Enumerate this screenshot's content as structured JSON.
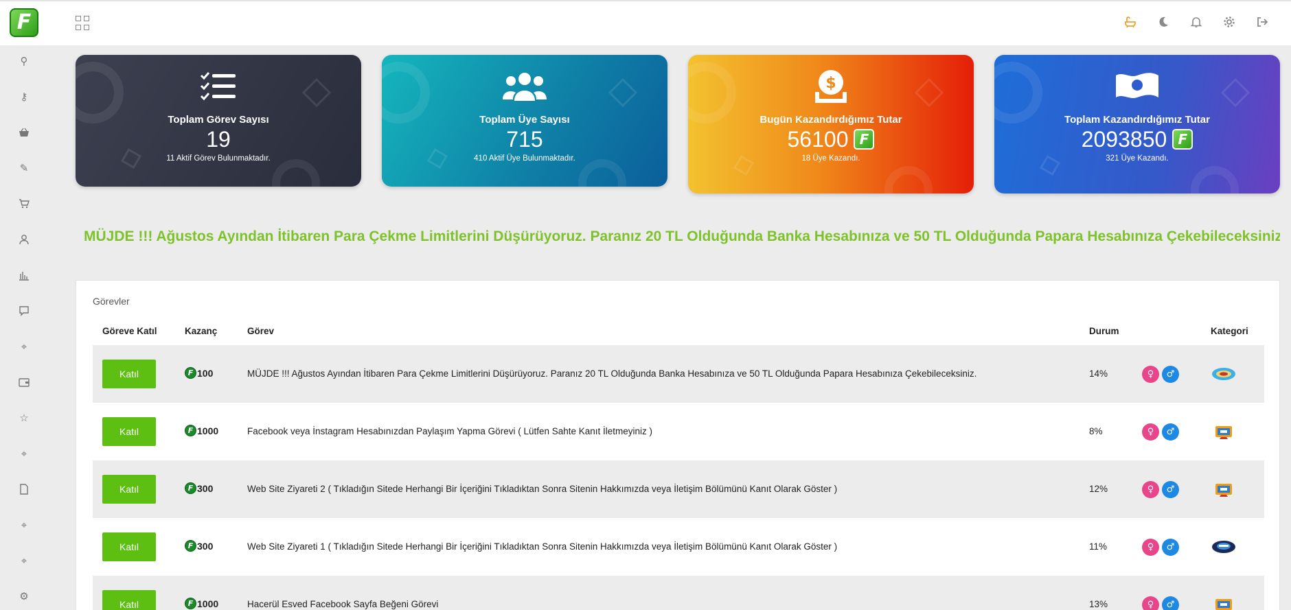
{
  "topbar": {
    "logo_letter": "F",
    "icons": [
      "bath-icon",
      "moon-icon",
      "bell-icon",
      "gear-icon",
      "logout-icon"
    ]
  },
  "sidebar": {
    "icons": [
      "key-icon",
      "key-alt-icon",
      "basket-icon",
      "pen-icon",
      "cart-icon",
      "user-icon",
      "chart-icon",
      "chat-icon",
      "target-icon",
      "wallet-icon",
      "star-icon",
      "target-icon",
      "file-icon",
      "target-icon",
      "target-icon",
      "gear-icon"
    ]
  },
  "cards": [
    {
      "title": "Toplam Görev Sayısı",
      "value": "19",
      "sub": "11 Aktif Görev Bulunmaktadır.",
      "icon": "checklist-icon"
    },
    {
      "title": "Toplam Üye Sayısı",
      "value": "715",
      "sub": "410 Aktif Üye Bulunmaktadır.",
      "icon": "users-icon"
    },
    {
      "title": "Bugün Kazandırdığımız Tutar",
      "value": "56100",
      "sub": "18 Üye Kazandı.",
      "icon": "money-icon"
    },
    {
      "title": "Toplam Kazandırdığımız Tutar",
      "value": "2093850",
      "sub": "321 Üye Kazandı.",
      "icon": "flag-icon"
    }
  ],
  "announcement": "MÜJDE !!! Ağustos Ayından İtibaren Para Çekme Limitlerini Düşürüyoruz. Paranız 20 TL Olduğunda Banka Hesabınıza ve 50 TL Olduğunda Papara Hesabınıza Çekebileceksiniz.",
  "tasks_panel": {
    "title": "Görevler",
    "columns": {
      "join": "Göreve Katıl",
      "reward": "Kazanç",
      "task": "Görev",
      "status": "Durum",
      "category": "Kategori"
    },
    "join_label": "Katıl",
    "rows": [
      {
        "reward": "100",
        "task": "MÜJDE !!! Ağustos Ayından İtibaren Para Çekme Limitlerini Düşürüyoruz. Paranız 20 TL Olduğunda Banka Hesabınıza ve 50 TL Olduğunda Papara Hesabınıza Çekebileceksiniz.",
        "status": "14%",
        "category_icon": "announcement-category-icon"
      },
      {
        "reward": "1000",
        "task": "Facebook veya İnstagram Hesabınızdan Paylaşım Yapma Görevi ( Lütfen Sahte Kanıt İletmeyiniz )",
        "status": "8%",
        "category_icon": "website-category-icon"
      },
      {
        "reward": "300",
        "task": "Web Site Ziyareti 2 ( Tıkladığın Sitede Herhangi Bir İçeriğini Tıkladıktan Sonra Sitenin Hakkımızda veya İletişim Bölümünü Kanıt Olarak Göster )",
        "status": "12%",
        "category_icon": "website-category-icon"
      },
      {
        "reward": "300",
        "task": "Web Site Ziyareti 1 ( Tıkladığın Sitede Herhangi Bir İçeriğini Tıkladıktan Sonra Sitenin Hakkımızda veya İletişim Bölümünü Kanıt Olarak Göster )",
        "status": "11%",
        "category_icon": "social-category-icon"
      },
      {
        "reward": "1000",
        "task": "Hacerül Esved Facebook Sayfa Beğeni Görevi",
        "status": "13%",
        "category_icon": "website-category-icon"
      }
    ]
  },
  "colors": {
    "accent_green": "#5cbf12",
    "announcement": "#7ec22a",
    "female": "#e8458a",
    "male": "#1e88e5"
  }
}
